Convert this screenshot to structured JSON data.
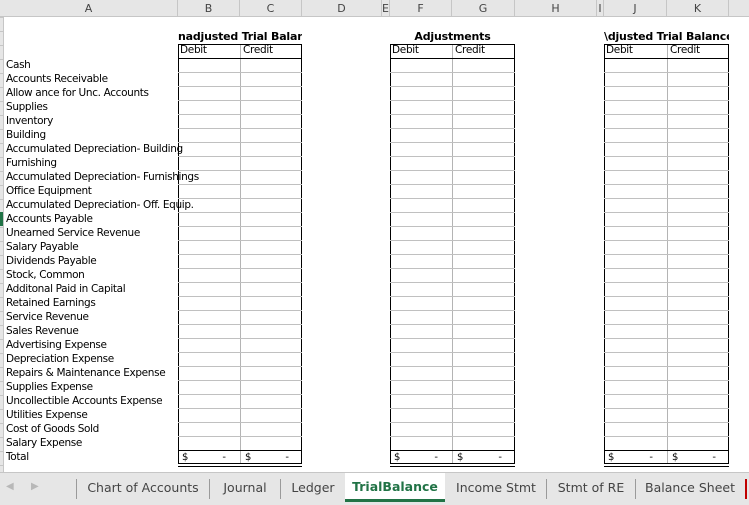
{
  "columns": [
    "A",
    "B",
    "C",
    "D",
    "E",
    "F",
    "G",
    "H",
    "I",
    "J",
    "K"
  ],
  "sections": [
    {
      "title": "nadjusted Trial Balanc",
      "full_title": "Unadjusted Trial Balance",
      "debit_label": "Debit",
      "credit_label": "Credit",
      "total_debit_symbol": "$",
      "total_debit_value": "-",
      "total_credit_symbol": "$",
      "total_credit_value": "-"
    },
    {
      "title": "Adjustments",
      "full_title": "Adjustments",
      "debit_label": "Debit",
      "credit_label": "Credit",
      "total_debit_symbol": "$",
      "total_debit_value": "-",
      "total_credit_symbol": "$",
      "total_credit_value": "-"
    },
    {
      "title": "\\djusted Trial Balance'",
      "full_title": "Adjusted Trial Balance",
      "debit_label": "Debit",
      "credit_label": "Credit",
      "total_debit_symbol": "$",
      "total_debit_value": "-",
      "total_credit_symbol": "$",
      "total_credit_value": "-"
    }
  ],
  "accounts": [
    "Cash",
    "Accounts Receivable",
    "Allow ance for Unc. Accounts",
    "Supplies",
    "Inventory",
    "Building",
    "Accumulated Depreciation- Building",
    "Furnishing",
    "Accumulated Depreciation- Furnishings",
    "Office Equipment",
    "Accumulated Depreciation- Off. Equip.",
    "Accounts Payable",
    "Unearned Service Revenue",
    "Salary Payable",
    "Dividends Payable",
    "Stock, Common",
    "Additonal Paid in Capital",
    "Retained Earnings",
    "Service Revenue",
    "Sales Revenue",
    "Advertising Expense",
    "Depreciation Expense",
    "Repairs & Maintenance Expense",
    "Supplies Expense",
    "Uncollectible Accounts Expense",
    "Utilities Expense",
    "Cost of Goods Sold",
    "Salary Expense"
  ],
  "total_label": "Total",
  "active_row_index": 11,
  "tabs": [
    {
      "label": "Chart of Accounts",
      "active": false
    },
    {
      "label": "Journal",
      "active": false
    },
    {
      "label": "Ledger",
      "active": false
    },
    {
      "label": "TrialBalance",
      "active": true
    },
    {
      "label": "Income Stmt",
      "active": false
    },
    {
      "label": "Stmt of RE",
      "active": false
    },
    {
      "label": "Balance Sheet",
      "active": false
    }
  ],
  "nav": {
    "prev_icon": "◀",
    "next_icon": "▶"
  },
  "colors": {
    "accent": "#217346",
    "tab_marker": "#c00000"
  }
}
